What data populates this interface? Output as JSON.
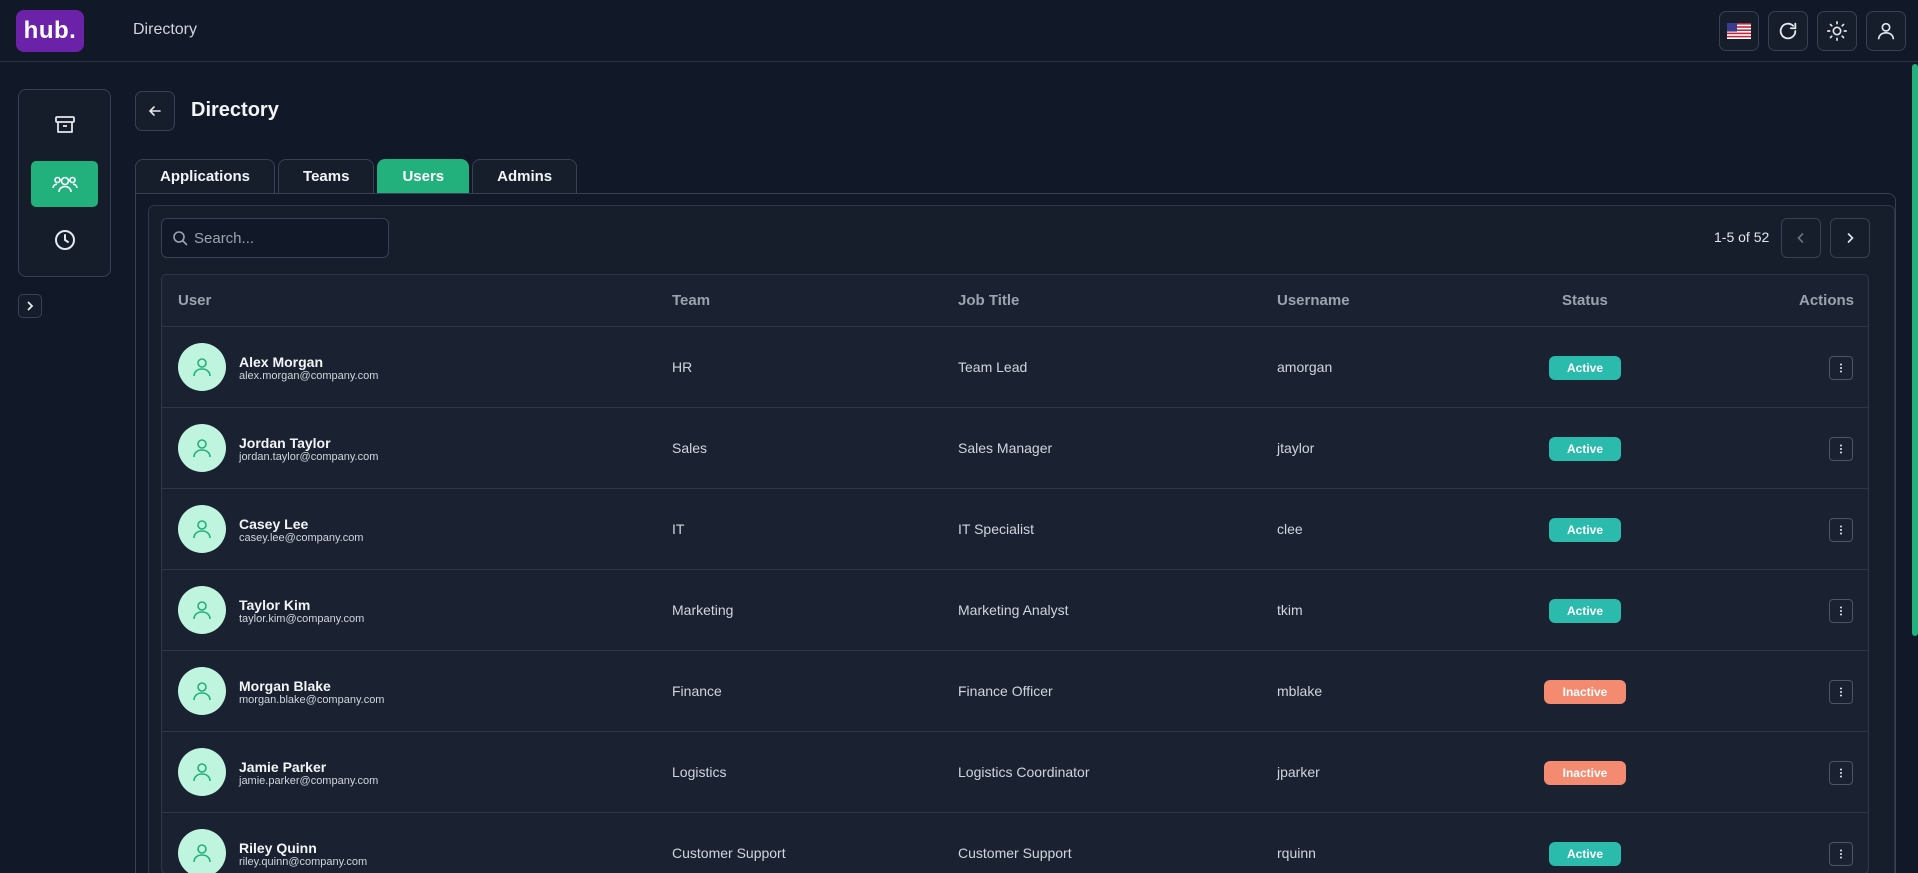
{
  "app": {
    "logo": "hub.",
    "title": "Directory"
  },
  "topbar": {
    "icons": [
      "us-flag-icon",
      "refresh-icon",
      "sun-icon",
      "user-profile-icon"
    ]
  },
  "sidebar": {
    "items": [
      {
        "icon": "archive-icon",
        "active": false
      },
      {
        "icon": "users-icon",
        "active": true
      },
      {
        "icon": "clock-icon",
        "active": false
      }
    ],
    "expand_icon": "chevron-right-icon"
  },
  "page": {
    "title": "Directory",
    "back_icon": "arrow-left-icon"
  },
  "tabs": [
    {
      "label": "Applications",
      "active": false
    },
    {
      "label": "Teams",
      "active": false
    },
    {
      "label": "Users",
      "active": true
    },
    {
      "label": "Admins",
      "active": false
    }
  ],
  "search": {
    "placeholder": "Search...",
    "value": ""
  },
  "pagination": {
    "text": "1-5 of 52"
  },
  "table": {
    "headers": {
      "user": "User",
      "team": "Team",
      "job_title": "Job Title",
      "username": "Username",
      "status": "Status",
      "actions": "Actions"
    },
    "rows": [
      {
        "name": "Alex Morgan",
        "email": "alex.morgan@company.com",
        "team": "HR",
        "job_title": "Team Lead",
        "username": "amorgan",
        "status": "Active"
      },
      {
        "name": "Jordan Taylor",
        "email": "jordan.taylor@company.com",
        "team": "Sales",
        "job_title": "Sales Manager",
        "username": "jtaylor",
        "status": "Active"
      },
      {
        "name": "Casey Lee",
        "email": "casey.lee@company.com",
        "team": "IT",
        "job_title": "IT Specialist",
        "username": "clee",
        "status": "Active"
      },
      {
        "name": "Taylor Kim",
        "email": "taylor.kim@company.com",
        "team": "Marketing",
        "job_title": "Marketing Analyst",
        "username": "tkim",
        "status": "Active"
      },
      {
        "name": "Morgan Blake",
        "email": "morgan.blake@company.com",
        "team": "Finance",
        "job_title": "Finance Officer",
        "username": "mblake",
        "status": "Inactive"
      },
      {
        "name": "Jamie Parker",
        "email": "jamie.parker@company.com",
        "team": "Logistics",
        "job_title": "Logistics Coordinator",
        "username": "jparker",
        "status": "Inactive"
      },
      {
        "name": "Riley Quinn",
        "email": "riley.quinn@company.com",
        "team": "Customer Support",
        "job_title": "Customer Support",
        "username": "rquinn",
        "status": "Active"
      }
    ]
  },
  "colors": {
    "accent": "#22b07d",
    "active_badge": "#2bbbad",
    "inactive_badge": "#f48a6f",
    "logo_bg": "#6b21a8"
  }
}
